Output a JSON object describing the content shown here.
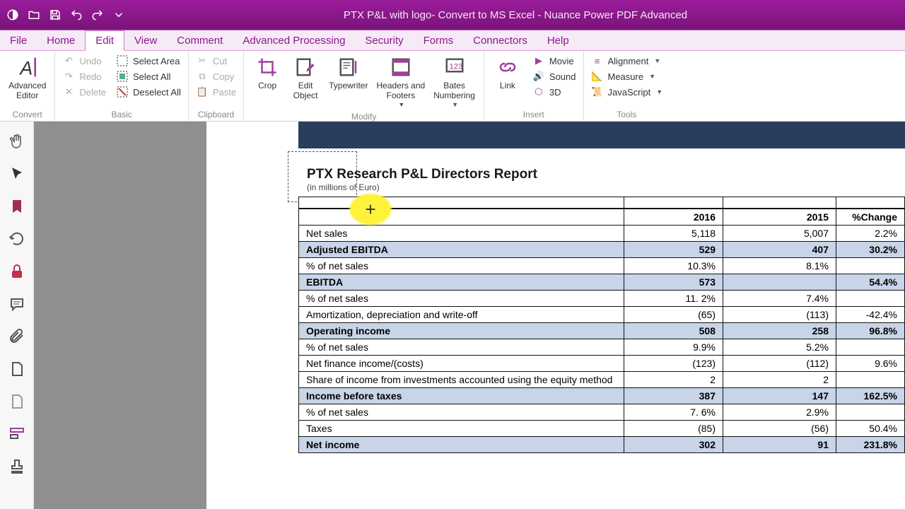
{
  "title_bar": {
    "text": "PTX P&L with logo- Convert to MS Excel - Nuance Power PDF Advanced"
  },
  "menu": {
    "file": "File",
    "home": "Home",
    "edit": "Edit",
    "view": "View",
    "comment": "Comment",
    "advanced_processing": "Advanced Processing",
    "security": "Security",
    "forms": "Forms",
    "connectors": "Connectors",
    "help": "Help"
  },
  "ribbon": {
    "convert": {
      "advanced_editor": "Advanced\nEditor",
      "group": "Convert"
    },
    "basic": {
      "undo": "Undo",
      "redo": "Redo",
      "delete": "Delete",
      "select_area": "Select Area",
      "select_all": "Select All",
      "deselect_all": "Deselect All",
      "group": "Basic"
    },
    "clipboard": {
      "cut": "Cut",
      "copy": "Copy",
      "paste": "Paste",
      "group": "Clipboard"
    },
    "modify": {
      "crop": "Crop",
      "edit_object": "Edit\nObject",
      "typewriter": "Typewriter",
      "headers_footers": "Headers and\nFooters",
      "bates": "Bates\nNumbering",
      "group": "Modify"
    },
    "insert": {
      "link": "Link",
      "group": "Insert"
    },
    "tools": {
      "movie": "Movie",
      "sound": "Sound",
      "threeD": "3D",
      "alignment": "Alignment",
      "measure": "Measure",
      "javascript": "JavaScript",
      "group": "Tools"
    }
  },
  "report": {
    "title": "PTX Research P&L Directors Report",
    "subtitle": "(in millions of Euro)",
    "columns": [
      "",
      "2016",
      "2015",
      "%Change"
    ],
    "rows": [
      {
        "label": "Net sales",
        "c2016": "5,118",
        "c2015": "5,007",
        "chg": "2.2%",
        "shaded": false
      },
      {
        "label": "Adjusted EBITDA",
        "c2016": "529",
        "c2015": "407",
        "chg": "30.2%",
        "shaded": true
      },
      {
        "label": "% of net sales",
        "c2016": "10.3%",
        "c2015": "8.1%",
        "chg": "",
        "shaded": false
      },
      {
        "label": "EBITDA",
        "c2016": "573",
        "c2015": "",
        "chg": "54.4%",
        "shaded": true
      },
      {
        "label": "% of net sales",
        "c2016": "11. 2%",
        "c2015": "7.4%",
        "chg": "",
        "shaded": false
      },
      {
        "label": "Amortization, depreciation and write-off",
        "c2016": "(65)",
        "c2015": "(113)",
        "chg": "-42.4%",
        "shaded": false
      },
      {
        "label": "Operating income",
        "c2016": "508",
        "c2015": "258",
        "chg": "96.8%",
        "shaded": true
      },
      {
        "label": "% of net sales",
        "c2016": "9.9%",
        "c2015": "5.2%",
        "chg": "",
        "shaded": false
      },
      {
        "label": "Net finance income/(costs)",
        "c2016": "(123)",
        "c2015": "(112)",
        "chg": "9.6%",
        "shaded": false
      },
      {
        "label": "Share of income from investments  accounted using the equity method",
        "c2016": "2",
        "c2015": "2",
        "chg": "",
        "shaded": false,
        "wrap": true
      },
      {
        "label": "Income before taxes",
        "c2016": "387",
        "c2015": "147",
        "chg": "162.5%",
        "shaded": true
      },
      {
        "label": "% of net sales",
        "c2016": "7. 6%",
        "c2015": "2.9%",
        "chg": "",
        "shaded": false
      },
      {
        "label": "Taxes",
        "c2016": "(85)",
        "c2015": "(56)",
        "chg": "50.4%",
        "shaded": false
      },
      {
        "label": "Net income",
        "c2016": "302",
        "c2015": "91",
        "chg": "231.8%",
        "shaded": true
      }
    ]
  }
}
